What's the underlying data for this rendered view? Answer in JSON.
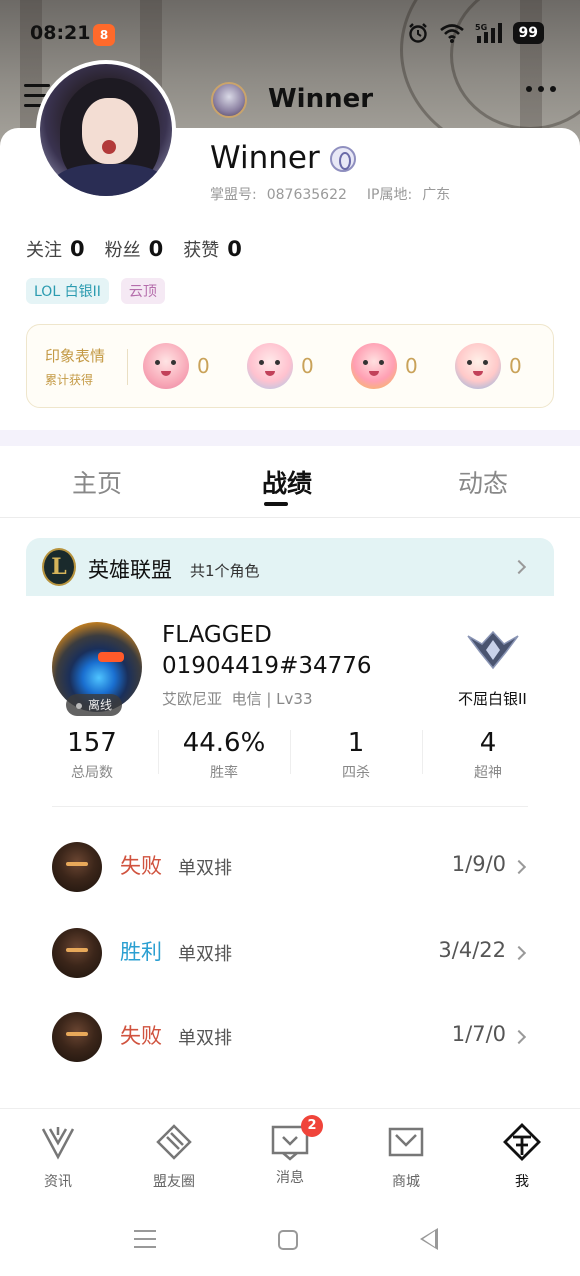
{
  "status_bar": {
    "time": "08:21",
    "app_badge": "8",
    "battery": "99",
    "icons": [
      "alarm-icon",
      "wifi-icon",
      "5g-signal-icon",
      "battery-icon"
    ]
  },
  "top_bar": {
    "title": "Winner",
    "icons": [
      "menu-icon",
      "more-icon"
    ]
  },
  "profile": {
    "name": "Winner",
    "id_label": "掌盟号:",
    "id_value": "087635622",
    "ip_label": "IP属地:",
    "ip_value": "广东",
    "counts": [
      {
        "label": "关注",
        "value": "0"
      },
      {
        "label": "粉丝",
        "value": "0"
      },
      {
        "label": "获赞",
        "value": "0"
      }
    ],
    "tags": [
      "LOL 白银II",
      "云顶"
    ],
    "impressions": {
      "title": "印象表情",
      "subtitle": "累计获得",
      "items": [
        {
          "icon": "blushing-sticker-icon",
          "count": "0"
        },
        {
          "icon": "waving-sticker-icon",
          "count": "0"
        },
        {
          "icon": "crying-sticker-icon",
          "count": "0"
        },
        {
          "icon": "surprised-sticker-icon",
          "count": "0"
        }
      ]
    }
  },
  "tabs": [
    {
      "label": "主页",
      "active": false
    },
    {
      "label": "战绩",
      "active": true
    },
    {
      "label": "动态",
      "active": false
    }
  ],
  "game": {
    "title": "英雄联盟",
    "subtitle": "共1个角色",
    "player": {
      "name_line1": "FLAGGED",
      "name_line2": "01904419#34776",
      "server": "艾欧尼亚",
      "network": "电信",
      "level": "Lv33",
      "status": "离线",
      "rank": "不屈白银II"
    },
    "stats": [
      {
        "value": "157",
        "label": "总局数"
      },
      {
        "value": "44.6%",
        "label": "胜率"
      },
      {
        "value": "1",
        "label": "四杀"
      },
      {
        "value": "4",
        "label": "超神"
      }
    ],
    "matches": [
      {
        "result": "失败",
        "outcome": "lose",
        "mode": "单双排",
        "kda": "1/9/0"
      },
      {
        "result": "胜利",
        "outcome": "win",
        "mode": "单双排",
        "kda": "3/4/22"
      },
      {
        "result": "失败",
        "outcome": "lose",
        "mode": "单双排",
        "kda": "1/7/0"
      }
    ]
  },
  "bottom_nav": [
    {
      "label": "资讯",
      "icon": "news-icon"
    },
    {
      "label": "盟友圈",
      "icon": "friends-circle-icon"
    },
    {
      "label": "消息",
      "icon": "message-icon",
      "badge": "2"
    },
    {
      "label": "商城",
      "icon": "shop-icon"
    },
    {
      "label": "我",
      "icon": "me-icon",
      "active": true
    }
  ],
  "colors": {
    "lose": "#d0523e",
    "win": "#2b9fd1",
    "gold": "#c49a46",
    "badge_red": "#f0443a"
  }
}
